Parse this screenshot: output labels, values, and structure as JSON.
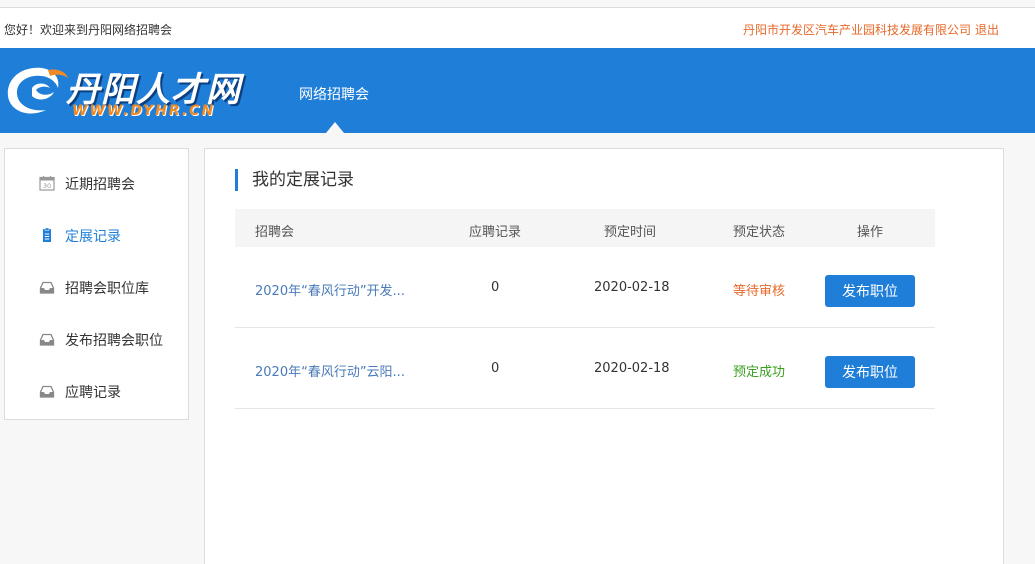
{
  "topbar": {
    "welcome": "您好！欢迎来到丹阳网络招聘会",
    "company": "丹阳市开发区汽车产业园科技发展有限公司",
    "logout": "退出"
  },
  "header": {
    "logo_name": "丹阳人才网",
    "logo_url": "WWW.DYHR.CN",
    "nav": [
      "网络招聘会"
    ]
  },
  "sidebar": {
    "items": [
      {
        "label": "近期招聘会",
        "icon": "calendar-icon",
        "active": false
      },
      {
        "label": "定展记录",
        "icon": "document-icon",
        "active": true
      },
      {
        "label": "招聘会职位库",
        "icon": "inbox-icon",
        "active": false
      },
      {
        "label": "发布招聘会职位",
        "icon": "inbox-icon",
        "active": false
      },
      {
        "label": "应聘记录",
        "icon": "inbox-icon",
        "active": false
      }
    ],
    "calendar_day": "30"
  },
  "main": {
    "title": "我的定展记录",
    "columns": [
      "招聘会",
      "应聘记录",
      "预定时间",
      "预定状态",
      "操作"
    ],
    "rows": [
      {
        "name": "2020年“春风行动”开发...",
        "count": "0",
        "date": "2020-02-18",
        "status": "等待审核",
        "action": "发布职位"
      },
      {
        "name": "2020年“春风行动”云阳...",
        "count": "0",
        "date": "2020-02-18",
        "status": "预定成功",
        "action": "发布职位"
      }
    ]
  },
  "colors": {
    "primary": "#1f7fd8",
    "accent_orange": "#e8692a",
    "success_green": "#3aa020",
    "link_blue": "#4a7ab8"
  }
}
